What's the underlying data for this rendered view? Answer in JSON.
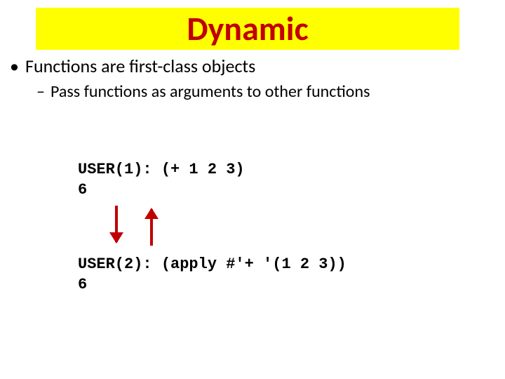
{
  "title": "Dynamic",
  "bullet_l1": "Functions are first-class objects",
  "bullet_l2": "Pass functions as arguments to other functions",
  "code1": "USER(1): (+ 1 2 3)\n6",
  "code2": "USER(2): (apply #'+ '(1 2 3))\n6"
}
